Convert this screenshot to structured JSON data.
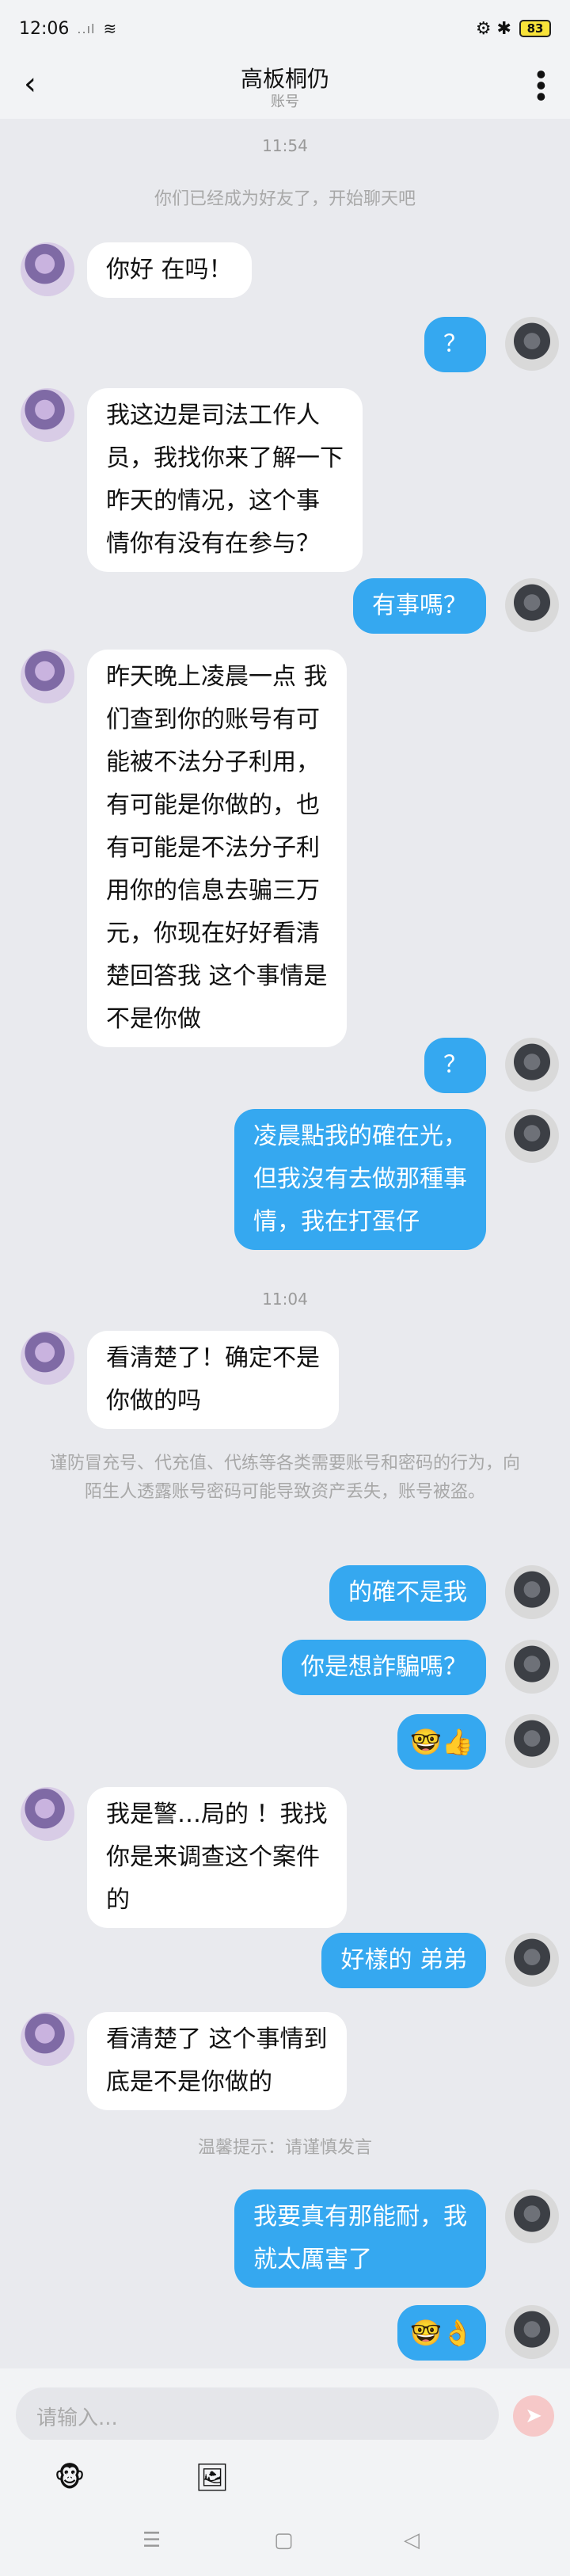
{
  "status": {
    "time": "12:06",
    "signal": "..ıl",
    "wifi": "≋",
    "right_icons": "⚙ ✱",
    "battery": "83"
  },
  "header": {
    "back_icon": "‹",
    "title": "高板桐仍",
    "subtitle": "账号",
    "more_icon": "•••"
  },
  "messages": {
    "time1": "11:54",
    "notice1": "你们已经成为好友了，开始聊天吧",
    "m1": "你好 在吗！",
    "m2": "？",
    "m3": "我这边是司法工作人\n员，我找你来了解一下\n昨天的情况，这个事\n情你有没有在参与？",
    "m4": "有事嗎？",
    "m5": "昨天晚上凌晨一点 我\n们查到你的账号有可\n能被不法分子利用，\n有可能是你做的，也\n有可能是不法分子利\n用你的信息去骗三万\n元，你现在好好看清\n楚回答我 这个事情是\n不是你做",
    "m6": "？",
    "m7": "凌晨點我的確在光，\n但我沒有去做那種事\n情，我在打蛋仔",
    "time2": "11:04",
    "m8": "看清楚了！确定不是\n你做的吗",
    "notice2": "谨防冒充号、代充值、代练等各类需要账号和密码的行为，向陌生人透露账号密码可能导致资产丢失，账号被盗。",
    "m9": "的確不是我",
    "m10": "你是想詐騙嗎？",
    "m11": "🤓👍",
    "m12": "我是警…局的 ！我找\n你是来调查这个案件\n的",
    "m13": "好樣的 弟弟",
    "m14": "看清楚了 这个事情到\n底是不是你做的",
    "notice3": "温馨提示：请谨慎发言",
    "m15": "我要真有那能耐，我\n就太厲害了",
    "m16": "🤓👌"
  },
  "input": {
    "placeholder": "请输入...",
    "send_icon": "➤"
  },
  "tools": {
    "sticker_icon": "🐵",
    "image_icon": "🖼"
  },
  "nav": {
    "menu_icon": "☰",
    "home_icon": "▢",
    "back_icon": "◁"
  }
}
